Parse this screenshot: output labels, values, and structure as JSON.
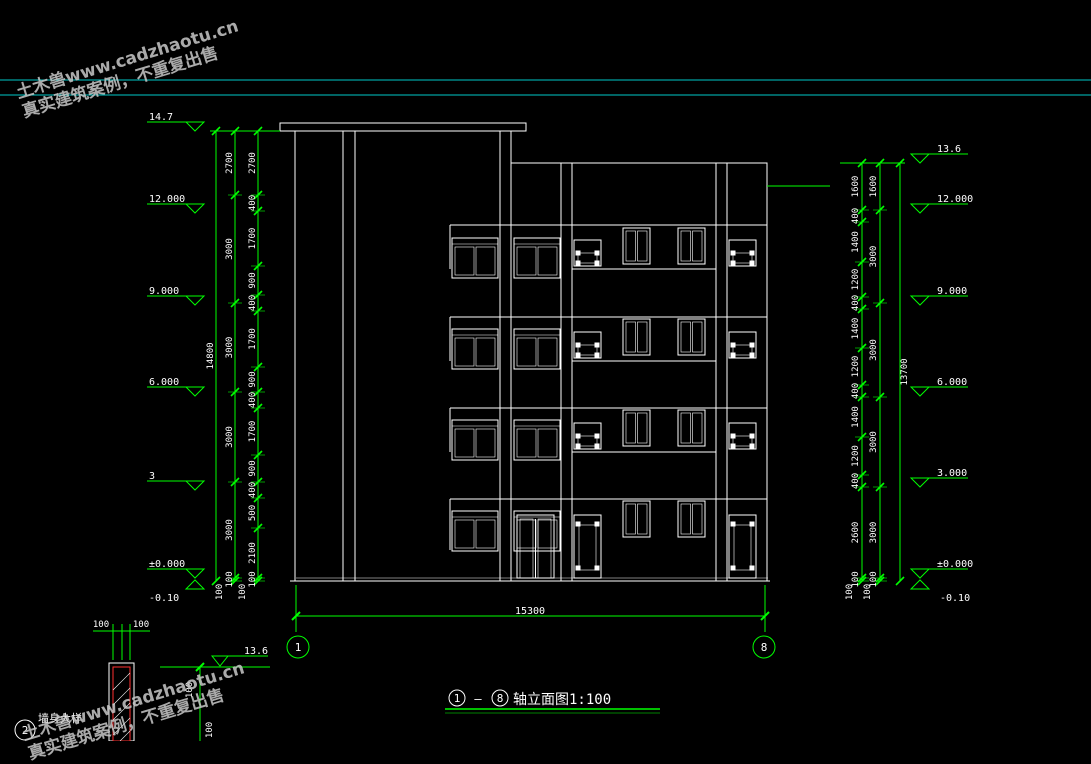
{
  "watermark": {
    "line1": "土木兽www.cadzhaotu.cn",
    "line2": "真实建筑案例，不重复出售"
  },
  "colors": {
    "background": "#000000",
    "building": "#ffffff",
    "dimension": "#00ff00",
    "elevation_mark": "#00ff00",
    "guide_line": "#00c8c8",
    "label": "#ffffff"
  },
  "elevations_left": [
    "14.7",
    "12.000",
    "9.000",
    "6.000",
    "3",
    "±0.000",
    "-0.10"
  ],
  "elevations_right": [
    "13.6",
    "12.000",
    "9.000",
    "6.000",
    "3.000",
    "±0.000",
    "-0.10"
  ],
  "dims_left_inner": [
    "2700",
    "400",
    "1700",
    "900",
    "400",
    "1700",
    "900",
    "400",
    "1700",
    "900",
    "400",
    "500",
    "2100",
    "100"
  ],
  "dims_left_outer": [
    "2700",
    "3000",
    "3000",
    "3000",
    "3000",
    "100"
  ],
  "dim_left_total": "14800",
  "dims_right_inner": [
    "1600",
    "400",
    "1400",
    "1200",
    "400",
    "1400",
    "1200",
    "400",
    "1400",
    "1200",
    "400",
    "2600",
    "100"
  ],
  "dims_right_outer": [
    "1600",
    "3000",
    "3000",
    "3000",
    "3000",
    "100"
  ],
  "dim_right_total": "13700",
  "dim_bottom": "15300",
  "axis_left": "1",
  "axis_right": "8",
  "title": {
    "from": "1",
    "dash": "—",
    "to": "8",
    "text": "轴立面图1:100"
  },
  "detail": {
    "dim_a": "100",
    "dim_b": "100",
    "elev": "13.6",
    "num": "2",
    "label": "墙身大样"
  }
}
